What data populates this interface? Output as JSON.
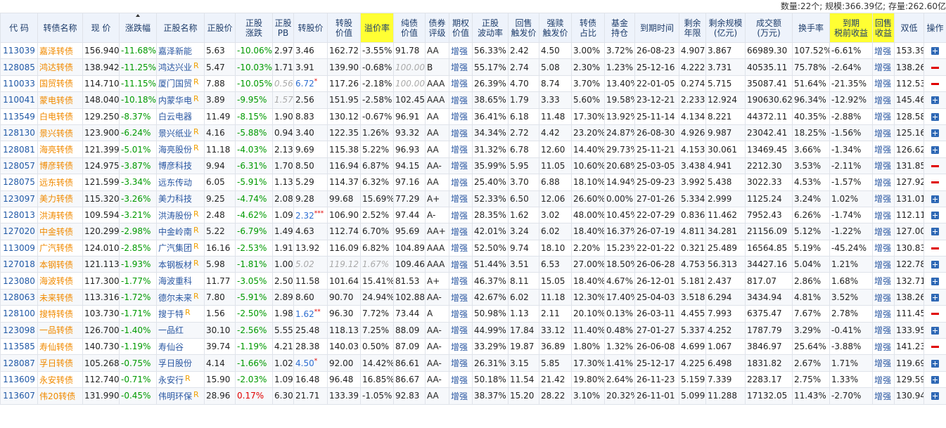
{
  "summary": "数量:22个; 规模:366.39亿; 存量:262.60亿",
  "headers": [
    {
      "label": "代 码"
    },
    {
      "label": "转债名称"
    },
    {
      "label": "现 价"
    },
    {
      "label": "涨跌幅"
    },
    {
      "label": "正股名称"
    },
    {
      "label": "正股价"
    },
    {
      "label": "正股\n涨跌"
    },
    {
      "label": "正股\nPB"
    },
    {
      "label": "转股价"
    },
    {
      "label": "转股\n价值"
    },
    {
      "label": "溢价率",
      "hl": true
    },
    {
      "label": "纯债\n价值"
    },
    {
      "label": "债券\n评级"
    },
    {
      "label": "期权\n价值"
    },
    {
      "label": "正股\n波动率"
    },
    {
      "label": "回售\n触发价"
    },
    {
      "label": "强赎\n触发价"
    },
    {
      "label": "转债\n占比"
    },
    {
      "label": "基金\n持仓"
    },
    {
      "label": "到期时间"
    },
    {
      "label": "剩余\n年限"
    },
    {
      "label": "剩余规模\n(亿元)"
    },
    {
      "label": "成交额\n(万元)"
    },
    {
      "label": "换手率"
    },
    {
      "label": "到期\n税前收益",
      "hl": true
    },
    {
      "label": "回售\n收益",
      "hl": true
    },
    {
      "label": "双低"
    },
    {
      "label": "操作"
    }
  ],
  "rows": [
    {
      "code": "113039",
      "name": "嘉泽转债",
      "price": "156.940",
      "chg": "-11.68%",
      "stock": "嘉泽新能",
      "mk": "",
      "sp": "5.63",
      "schg": "-10.06%",
      "pb": "2.97",
      "pb_dim": false,
      "cv": "3.46",
      "cv_mark": "",
      "cval": "162.72",
      "cval_dim": false,
      "prem": "-3.55%",
      "prem_dim": false,
      "bond": "91.78",
      "bond_dim": false,
      "rating": "AA",
      "opt": "增强",
      "vol": "56.33%",
      "put": "2.42",
      "call": "4.50",
      "ratio": "3.00%",
      "fund": "3.72%",
      "mat": "26-08-23",
      "yrs": "4.907",
      "size": "3.867",
      "amt": "66989.30",
      "turn": "107.52%",
      "ytm": "-6.61%",
      "ytm_pos": false,
      "pyld": "增强",
      "dl": "153.39",
      "op": "plus"
    },
    {
      "code": "128085",
      "name": "鸿达转债",
      "price": "138.942",
      "chg": "-11.25%",
      "stock": "鸿达兴业",
      "mk": "R",
      "sp": "5.47",
      "schg": "-10.03%",
      "pb": "1.71",
      "pb_dim": false,
      "cv": "3.91",
      "cv_mark": "",
      "cval": "139.90",
      "cval_dim": false,
      "prem": "-0.68%",
      "prem_dim": false,
      "bond": "100.00",
      "bond_dim": true,
      "rating": "B",
      "opt": "增强",
      "vol": "55.17%",
      "put": "2.74",
      "call": "5.08",
      "ratio": "2.30%",
      "fund": "1.23%",
      "mat": "25-12-16",
      "yrs": "4.222",
      "size": "3.731",
      "amt": "40535.11",
      "turn": "75.78%",
      "ytm": "-2.64%",
      "ytm_pos": false,
      "pyld": "增强",
      "dl": "138.26",
      "op": "minus"
    },
    {
      "code": "110033",
      "name": "国贸转债",
      "price": "114.710",
      "chg": "-11.15%",
      "stock": "厦门国贸",
      "mk": "R",
      "sp": "7.88",
      "schg": "-10.05%",
      "pb": "0.56",
      "pb_dim": true,
      "cv": "6.72",
      "cv_mark": "*",
      "cval": "117.26",
      "cval_dim": false,
      "prem": "-2.18%",
      "prem_dim": false,
      "bond": "100.00",
      "bond_dim": true,
      "rating": "AAA",
      "opt": "增强",
      "vol": "26.39%",
      "put": "4.70",
      "call": "8.74",
      "ratio": "3.70%",
      "fund": "13.40%",
      "mat": "22-01-05",
      "yrs": "0.274",
      "size": "5.715",
      "amt": "35087.41",
      "turn": "51.64%",
      "ytm": "-21.35%",
      "ytm_pos": false,
      "pyld": "增强",
      "dl": "112.53",
      "op": "minus"
    },
    {
      "code": "110041",
      "name": "蒙电转债",
      "price": "148.040",
      "chg": "-10.18%",
      "stock": "内蒙华电",
      "mk": "R",
      "sp": "3.89",
      "schg": "-9.95%",
      "pb": "1.57",
      "pb_dim": true,
      "cv": "2.56",
      "cv_mark": "",
      "cval": "151.95",
      "cval_dim": false,
      "prem": "-2.58%",
      "prem_dim": false,
      "bond": "102.45",
      "bond_dim": false,
      "rating": "AAA",
      "opt": "增强",
      "vol": "38.65%",
      "put": "1.79",
      "call": "3.33",
      "ratio": "5.60%",
      "fund": "19.58%",
      "mat": "23-12-21",
      "yrs": "2.233",
      "size": "12.924",
      "amt": "190630.62",
      "turn": "96.34%",
      "ytm": "-12.92%",
      "ytm_pos": false,
      "pyld": "增强",
      "dl": "145.46",
      "op": "plus"
    },
    {
      "code": "113549",
      "name": "白电转债",
      "price": "129.250",
      "chg": "-8.37%",
      "stock": "白云电器",
      "mk": "",
      "sp": "11.49",
      "schg": "-8.15%",
      "pb": "1.90",
      "pb_dim": false,
      "cv": "8.83",
      "cv_mark": "",
      "cval": "130.12",
      "cval_dim": false,
      "prem": "-0.67%",
      "prem_dim": false,
      "bond": "96.91",
      "bond_dim": false,
      "rating": "AA",
      "opt": "增强",
      "vol": "36.41%",
      "put": "6.18",
      "call": "11.48",
      "ratio": "17.30%",
      "fund": "13.92%",
      "mat": "25-11-14",
      "yrs": "4.134",
      "size": "8.221",
      "amt": "44372.11",
      "turn": "40.35%",
      "ytm": "-2.88%",
      "ytm_pos": false,
      "pyld": "增强",
      "dl": "128.58",
      "op": "plus"
    },
    {
      "code": "128130",
      "name": "景兴转债",
      "price": "123.900",
      "chg": "-6.24%",
      "stock": "景兴纸业",
      "mk": "R",
      "sp": "4.16",
      "schg": "-5.88%",
      "pb": "0.94",
      "pb_dim": false,
      "cv": "3.40",
      "cv_mark": "",
      "cval": "122.35",
      "cval_dim": false,
      "prem": "1.26%",
      "prem_dim": false,
      "bond": "93.32",
      "bond_dim": false,
      "rating": "AA",
      "opt": "增强",
      "vol": "34.34%",
      "put": "2.72",
      "call": "4.42",
      "ratio": "23.20%",
      "fund": "24.87%",
      "mat": "26-08-30",
      "yrs": "4.926",
      "size": "9.987",
      "amt": "23042.41",
      "turn": "18.25%",
      "ytm": "-1.56%",
      "ytm_pos": false,
      "pyld": "增强",
      "dl": "125.16",
      "op": "plus"
    },
    {
      "code": "128081",
      "name": "海亮转债",
      "price": "121.399",
      "chg": "-5.01%",
      "stock": "海亮股份",
      "mk": "R",
      "sp": "11.18",
      "schg": "-4.03%",
      "pb": "2.13",
      "pb_dim": false,
      "cv": "9.69",
      "cv_mark": "",
      "cval": "115.38",
      "cval_dim": false,
      "prem": "5.22%",
      "prem_dim": false,
      "bond": "96.93",
      "bond_dim": false,
      "rating": "AA",
      "opt": "增强",
      "vol": "31.32%",
      "put": "6.78",
      "call": "12.60",
      "ratio": "14.40%",
      "fund": "29.73%",
      "mat": "25-11-21",
      "yrs": "4.153",
      "size": "30.061",
      "amt": "13469.45",
      "turn": "3.66%",
      "ytm": "-1.34%",
      "ytm_pos": false,
      "pyld": "增强",
      "dl": "126.62",
      "op": "plus"
    },
    {
      "code": "128057",
      "name": "博彦转债",
      "price": "124.975",
      "chg": "-3.87%",
      "stock": "博彦科技",
      "mk": "",
      "sp": "9.94",
      "schg": "-6.31%",
      "pb": "1.70",
      "pb_dim": false,
      "cv": "8.50",
      "cv_mark": "",
      "cval": "116.94",
      "cval_dim": false,
      "prem": "6.87%",
      "prem_dim": false,
      "bond": "94.15",
      "bond_dim": false,
      "rating": "AA-",
      "opt": "增强",
      "vol": "35.99%",
      "put": "5.95",
      "call": "11.05",
      "ratio": "10.60%",
      "fund": "20.68%",
      "mat": "25-03-05",
      "yrs": "3.438",
      "size": "4.941",
      "amt": "2212.30",
      "turn": "3.53%",
      "ytm": "-2.11%",
      "ytm_pos": false,
      "pyld": "增强",
      "dl": "131.85",
      "op": "minus"
    },
    {
      "code": "128075",
      "name": "远东转债",
      "price": "121.599",
      "chg": "-3.34%",
      "stock": "远东传动",
      "mk": "",
      "sp": "6.05",
      "schg": "-5.91%",
      "pb": "1.13",
      "pb_dim": false,
      "cv": "5.29",
      "cv_mark": "",
      "cval": "114.37",
      "cval_dim": false,
      "prem": "6.32%",
      "prem_dim": false,
      "bond": "97.16",
      "bond_dim": false,
      "rating": "AA",
      "opt": "增强",
      "vol": "25.40%",
      "put": "3.70",
      "call": "6.88",
      "ratio": "18.10%",
      "fund": "14.94%",
      "mat": "25-09-23",
      "yrs": "3.992",
      "size": "5.438",
      "amt": "3022.33",
      "turn": "4.53%",
      "ytm": "-1.57%",
      "ytm_pos": false,
      "pyld": "增强",
      "dl": "127.92",
      "op": "minus"
    },
    {
      "code": "123097",
      "name": "美力转债",
      "price": "115.320",
      "chg": "-3.26%",
      "stock": "美力科技",
      "mk": "",
      "sp": "9.25",
      "schg": "-4.74%",
      "pb": "2.08",
      "pb_dim": false,
      "cv": "9.28",
      "cv_mark": "",
      "cval": "99.68",
      "cval_dim": false,
      "prem": "15.69%",
      "prem_dim": false,
      "bond": "77.29",
      "bond_dim": false,
      "rating": "A+",
      "opt": "增强",
      "vol": "52.33%",
      "put": "6.50",
      "call": "12.06",
      "ratio": "26.60%",
      "fund": "0.00%",
      "mat": "27-01-26",
      "yrs": "5.334",
      "size": "2.999",
      "amt": "1125.24",
      "turn": "3.24%",
      "ytm": "1.02%",
      "ytm_pos": true,
      "pyld": "增强",
      "dl": "131.01",
      "op": "plus"
    },
    {
      "code": "128013",
      "name": "洪涛转债",
      "price": "109.594",
      "chg": "-3.21%",
      "stock": "洪涛股份",
      "mk": "R",
      "sp": "2.48",
      "schg": "-4.62%",
      "pb": "1.09",
      "pb_dim": false,
      "cv": "2.32",
      "cv_mark": "***",
      "cval": "106.90",
      "cval_dim": false,
      "prem": "2.52%",
      "prem_dim": false,
      "bond": "97.44",
      "bond_dim": false,
      "rating": "A-",
      "opt": "增强",
      "vol": "28.35%",
      "put": "1.62",
      "call": "3.02",
      "ratio": "48.00%",
      "fund": "10.45%",
      "mat": "22-07-29",
      "yrs": "0.836",
      "size": "11.462",
      "amt": "7952.43",
      "turn": "6.26%",
      "ytm": "-1.74%",
      "ytm_pos": false,
      "pyld": "增强",
      "dl": "112.11",
      "op": "plus"
    },
    {
      "code": "127020",
      "name": "中金转债",
      "price": "120.299",
      "chg": "-2.98%",
      "stock": "中金岭南",
      "mk": "R",
      "sp": "5.22",
      "schg": "-6.79%",
      "pb": "1.49",
      "pb_dim": false,
      "cv": "4.63",
      "cv_mark": "",
      "cval": "112.74",
      "cval_dim": false,
      "prem": "6.70%",
      "prem_dim": false,
      "bond": "95.69",
      "bond_dim": false,
      "rating": "AA+",
      "opt": "增强",
      "vol": "42.01%",
      "put": "3.24",
      "call": "6.02",
      "ratio": "18.40%",
      "fund": "16.37%",
      "mat": "26-07-19",
      "yrs": "4.811",
      "size": "34.281",
      "amt": "21156.09",
      "turn": "5.12%",
      "ytm": "-1.22%",
      "ytm_pos": false,
      "pyld": "增强",
      "dl": "127.00",
      "op": "plus"
    },
    {
      "code": "113009",
      "name": "广汽转债",
      "price": "124.010",
      "chg": "-2.85%",
      "stock": "广汽集团",
      "mk": "R",
      "sp": "16.16",
      "schg": "-2.53%",
      "pb": "1.91",
      "pb_dim": false,
      "cv": "13.92",
      "cv_mark": "",
      "cval": "116.09",
      "cval_dim": false,
      "prem": "6.82%",
      "prem_dim": false,
      "bond": "104.89",
      "bond_dim": false,
      "rating": "AAA",
      "opt": "增强",
      "vol": "52.50%",
      "put": "9.74",
      "call": "18.10",
      "ratio": "2.20%",
      "fund": "15.23%",
      "mat": "22-01-22",
      "yrs": "0.321",
      "size": "25.489",
      "amt": "16564.85",
      "turn": "5.19%",
      "ytm": "-45.24%",
      "ytm_pos": false,
      "pyld": "增强",
      "dl": "130.83",
      "op": "minus"
    },
    {
      "code": "127018",
      "name": "本钢转债",
      "price": "121.113",
      "chg": "-1.93%",
      "stock": "本钢板材",
      "mk": "R",
      "sp": "5.98",
      "schg": "-1.81%",
      "pb": "1.00",
      "pb_dim": false,
      "cv": "5.02",
      "cv_mark": "",
      "cv_dim": true,
      "cval": "119.12",
      "cval_dim": true,
      "prem": "1.67%",
      "prem_dim": true,
      "bond": "109.46",
      "bond_dim": false,
      "rating": "AAA",
      "opt": "增强",
      "vol": "51.44%",
      "put": "3.51",
      "call": "6.53",
      "ratio": "27.00%",
      "fund": "18.50%",
      "mat": "26-06-28",
      "yrs": "4.753",
      "size": "56.313",
      "amt": "34427.16",
      "turn": "5.04%",
      "ytm": "1.21%",
      "ytm_pos": true,
      "pyld": "增强",
      "dl": "122.78",
      "op": "plus"
    },
    {
      "code": "123080",
      "name": "海波转债",
      "price": "117.300",
      "chg": "-1.77%",
      "stock": "海波重科",
      "mk": "",
      "sp": "11.77",
      "schg": "-3.05%",
      "pb": "2.50",
      "pb_dim": false,
      "cv": "11.58",
      "cv_mark": "",
      "cval": "101.64",
      "cval_dim": false,
      "prem": "15.41%",
      "prem_dim": false,
      "bond": "81.53",
      "bond_dim": false,
      "rating": "A+",
      "opt": "增强",
      "vol": "46.37%",
      "put": "8.11",
      "call": "15.05",
      "ratio": "18.40%",
      "fund": "4.67%",
      "mat": "26-12-01",
      "yrs": "5.181",
      "size": "2.437",
      "amt": "817.07",
      "turn": "2.86%",
      "ytm": "1.68%",
      "ytm_pos": true,
      "pyld": "增强",
      "dl": "132.71",
      "op": "plus"
    },
    {
      "code": "128063",
      "name": "未来转债",
      "price": "113.316",
      "chg": "-1.72%",
      "stock": "德尔未来",
      "mk": "R",
      "sp": "7.80",
      "schg": "-5.91%",
      "pb": "2.89",
      "pb_dim": false,
      "cv": "8.60",
      "cv_mark": "",
      "cval": "90.70",
      "cval_dim": false,
      "prem": "24.94%",
      "prem_dim": false,
      "bond": "102.88",
      "bond_dim": false,
      "rating": "AA-",
      "opt": "增强",
      "vol": "42.67%",
      "put": "6.02",
      "call": "11.18",
      "ratio": "12.30%",
      "fund": "17.40%",
      "mat": "25-04-03",
      "yrs": "3.518",
      "size": "6.294",
      "amt": "3434.94",
      "turn": "4.81%",
      "ytm": "3.52%",
      "ytm_pos": true,
      "pyld": "增强",
      "dl": "138.26",
      "op": "plus"
    },
    {
      "code": "128100",
      "name": "搜特转债",
      "price": "103.730",
      "chg": "-1.71%",
      "stock": "搜于特",
      "mk": "R",
      "sp": "1.56",
      "schg": "-2.50%",
      "pb": "1.98",
      "pb_dim": false,
      "cv": "1.62",
      "cv_mark": "**",
      "cval": "96.30",
      "cval_dim": false,
      "prem": "7.72%",
      "prem_dim": false,
      "bond": "73.44",
      "bond_dim": false,
      "rating": "A",
      "opt": "增强",
      "vol": "50.98%",
      "put": "1.13",
      "call": "2.11",
      "ratio": "20.10%",
      "fund": "0.13%",
      "mat": "26-03-11",
      "yrs": "4.455",
      "size": "7.993",
      "amt": "6375.47",
      "turn": "7.67%",
      "ytm": "2.78%",
      "ytm_pos": true,
      "pyld": "增强",
      "dl": "111.45",
      "op": "minus"
    },
    {
      "code": "123098",
      "name": "一品转债",
      "price": "126.700",
      "chg": "-1.40%",
      "stock": "一品红",
      "mk": "",
      "sp": "30.10",
      "schg": "-2.56%",
      "pb": "5.55",
      "pb_dim": false,
      "cv": "25.48",
      "cv_mark": "",
      "cval": "118.13",
      "cval_dim": false,
      "prem": "7.25%",
      "prem_dim": false,
      "bond": "88.09",
      "bond_dim": false,
      "rating": "AA-",
      "opt": "增强",
      "vol": "44.99%",
      "put": "17.84",
      "call": "33.12",
      "ratio": "11.40%",
      "fund": "0.48%",
      "mat": "27-01-27",
      "yrs": "5.337",
      "size": "4.252",
      "amt": "1787.79",
      "turn": "3.29%",
      "ytm": "-0.41%",
      "ytm_pos": false,
      "pyld": "增强",
      "dl": "133.95",
      "op": "plus"
    },
    {
      "code": "113585",
      "name": "寿仙转债",
      "price": "140.730",
      "chg": "-1.19%",
      "stock": "寿仙谷",
      "mk": "",
      "sp": "39.74",
      "schg": "-1.19%",
      "pb": "4.21",
      "pb_dim": false,
      "cv": "28.38",
      "cv_mark": "",
      "cval": "140.03",
      "cval_dim": false,
      "prem": "0.50%",
      "prem_dim": false,
      "bond": "87.09",
      "bond_dim": false,
      "rating": "AA-",
      "opt": "增强",
      "vol": "33.29%",
      "put": "19.87",
      "call": "36.89",
      "ratio": "1.80%",
      "fund": "1.32%",
      "mat": "26-06-08",
      "yrs": "4.699",
      "size": "1.067",
      "amt": "3846.97",
      "turn": "25.64%",
      "ytm": "-3.88%",
      "ytm_pos": false,
      "pyld": "增强",
      "dl": "141.23",
      "op": "minus"
    },
    {
      "code": "128087",
      "name": "孚日转债",
      "price": "105.268",
      "chg": "-0.75%",
      "stock": "孚日股份",
      "mk": "",
      "sp": "4.14",
      "schg": "-1.66%",
      "pb": "1.02",
      "pb_dim": false,
      "cv": "4.50",
      "cv_mark": "*",
      "cval": "92.00",
      "cval_dim": false,
      "prem": "14.42%",
      "prem_dim": false,
      "bond": "86.61",
      "bond_dim": false,
      "rating": "AA-",
      "opt": "增强",
      "vol": "26.31%",
      "put": "3.15",
      "call": "5.85",
      "ratio": "17.30%",
      "fund": "1.41%",
      "mat": "25-12-17",
      "yrs": "4.225",
      "size": "6.498",
      "amt": "1831.82",
      "turn": "2.67%",
      "ytm": "1.71%",
      "ytm_pos": true,
      "pyld": "增强",
      "dl": "119.69",
      "op": "plus"
    },
    {
      "code": "113609",
      "name": "永安转债",
      "price": "112.740",
      "chg": "-0.71%",
      "stock": "永安行",
      "mk": "R",
      "sp": "15.90",
      "schg": "-2.03%",
      "pb": "1.09",
      "pb_dim": false,
      "cv": "16.48",
      "cv_mark": "",
      "cval": "96.48",
      "cval_dim": false,
      "prem": "16.85%",
      "prem_dim": false,
      "bond": "86.67",
      "bond_dim": false,
      "rating": "AA-",
      "opt": "增强",
      "vol": "50.18%",
      "put": "11.54",
      "call": "21.42",
      "ratio": "19.80%",
      "fund": "2.64%",
      "mat": "26-11-23",
      "yrs": "5.159",
      "size": "7.339",
      "amt": "2283.17",
      "turn": "2.75%",
      "ytm": "1.33%",
      "ytm_pos": true,
      "pyld": "增强",
      "dl": "129.59",
      "op": "plus"
    },
    {
      "code": "113607",
      "name": "伟20转债",
      "price": "131.990",
      "chg": "-0.45%",
      "stock": "伟明环保",
      "mk": "R",
      "sp": "28.96",
      "schg": "0.17%",
      "schg_pos": true,
      "pb": "6.30",
      "pb_dim": false,
      "cv": "21.71",
      "cv_mark": "",
      "cval": "133.39",
      "cval_dim": false,
      "prem": "-1.05%",
      "prem_dim": false,
      "bond": "92.83",
      "bond_dim": false,
      "rating": "AA",
      "opt": "增强",
      "vol": "38.37%",
      "put": "15.20",
      "call": "28.22",
      "ratio": "3.10%",
      "fund": "20.32%",
      "mat": "26-11-01",
      "yrs": "5.099",
      "size": "11.288",
      "amt": "17132.05",
      "turn": "11.43%",
      "ytm": "-2.70%",
      "ytm_pos": false,
      "pyld": "增强",
      "dl": "130.94",
      "op": "plus"
    }
  ]
}
